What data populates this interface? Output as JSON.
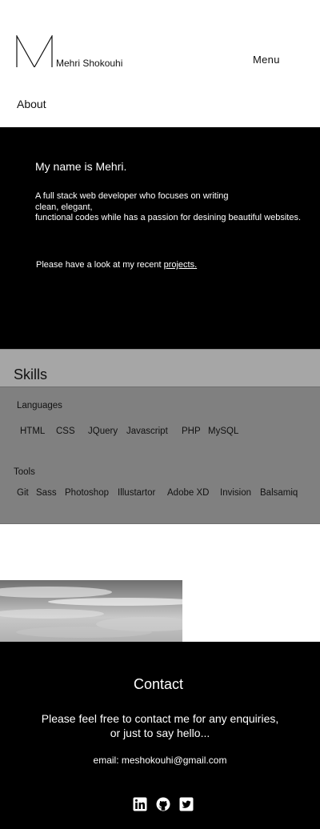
{
  "header": {
    "brand_name": "Mehri Shokouhi",
    "logo_letter": "M",
    "menu_label": "Menu",
    "about_label": "About"
  },
  "intro": {
    "greeting": "My name is Mehri.",
    "description_lines": [
      "A full stack  web developer who focuses on writing",
      "clean, elegant,",
      "functional codes while has a passion for desining beautiful websites."
    ],
    "cta_prefix": "Please have a look at my recent ",
    "cta_link": "projects."
  },
  "skills": {
    "title": "Skills",
    "languages_label": "Languages",
    "languages": [
      "HTML",
      "CSS",
      "JQuery",
      "Javascript",
      "PHP",
      "MySQL"
    ],
    "tools_label": "Tools",
    "tools": [
      "Git",
      "Sass",
      "Photoshop",
      "Illustartor",
      "Adobe XD",
      "Invision",
      "Balsamiq"
    ]
  },
  "contact": {
    "title": "Contact",
    "message_line1": "Please feel free to contact me for  any enquiries,",
    "message_line2": "or just to say hello...",
    "email_line": "email: meshokouhi@gmail.com",
    "social_icons": [
      "linkedin-icon",
      "github-icon",
      "twitter-icon"
    ]
  },
  "colors": {
    "dark_section": "#000000",
    "skills_header": "#a6a6a6",
    "skills_body": "#808080",
    "text_light": "#ffffff"
  }
}
